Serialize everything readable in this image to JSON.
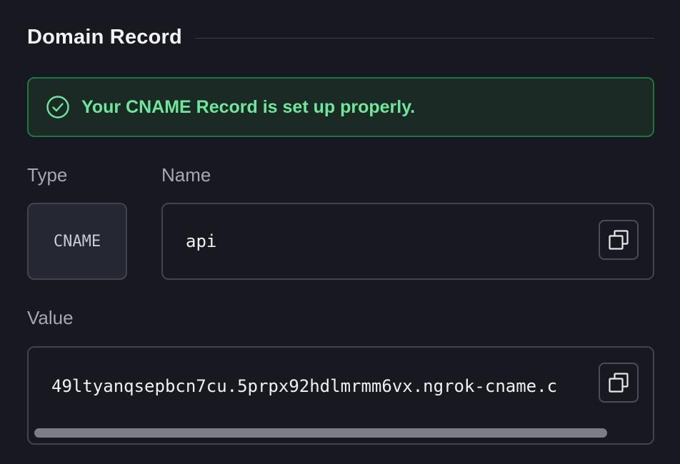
{
  "section": {
    "title": "Domain Record"
  },
  "alert": {
    "message": "Your CNAME Record is set up properly.",
    "icon": "check-circle-icon",
    "color": "#6ee79a"
  },
  "record": {
    "type_label": "Type",
    "type_value": "CNAME",
    "name_label": "Name",
    "name_value": "api",
    "value_label": "Value",
    "value_value": "49ltyanqsepbcn7cu.5prpx92hdlmrmm6vx.ngrok-cname.c"
  },
  "icons": {
    "copy": "copy-icon"
  }
}
